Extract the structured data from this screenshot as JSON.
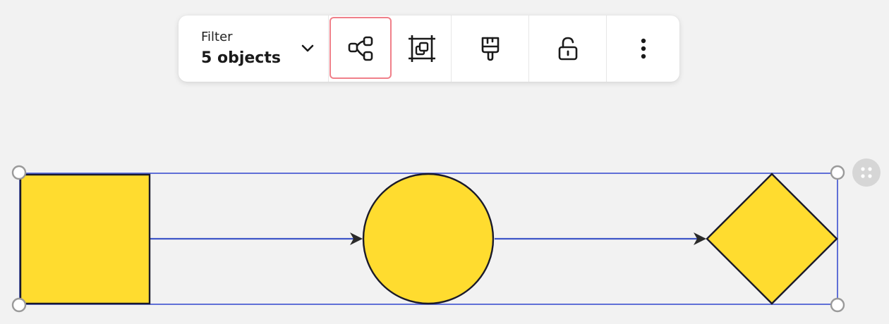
{
  "toolbar": {
    "filter_label": "Filter",
    "filter_count": "5 objects",
    "buttons": [
      {
        "icon": "diagram-connect-icon",
        "selected": true
      },
      {
        "icon": "frame-group-icon"
      },
      {
        "icon": "paint-brush-icon"
      },
      {
        "icon": "unlock-icon"
      },
      {
        "icon": "more-vertical-icon"
      }
    ]
  },
  "canvas": {
    "shape_fill": "#ffdc2f",
    "shape_stroke": "#1a1a2a",
    "selection_color": "#3b4fd0",
    "connector_color": "#3f56c8",
    "handle_color": "#9a9a9a"
  }
}
